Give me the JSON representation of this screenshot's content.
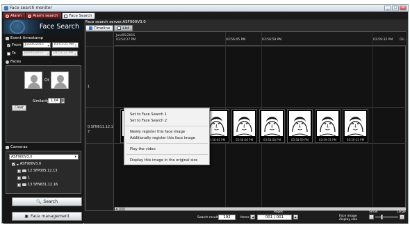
{
  "window": {
    "title": "Face search monitor",
    "min": "_",
    "max": "□",
    "close": "×"
  },
  "tabs": [
    {
      "label": "Alarm"
    },
    {
      "label": "Alarm search"
    },
    {
      "label": "Face Search"
    }
  ],
  "left": {
    "header_title": "Face Search",
    "event_timestamp_label": "Event timestamp",
    "from_label": "From",
    "from_date": "Jun/05/2015",
    "from_time": "03:51:21 PM",
    "to_label": "To",
    "to_date": "Jun/05/2015",
    "to_time": "04:51:21 PM",
    "faces_label": "Faces",
    "or_label": "Or",
    "similarity_label": "Similarity",
    "similarity_value": "1.04",
    "clear_button": "Clear",
    "cameras_label": "Cameras",
    "camera_select": "ASF900V3.0",
    "tree": [
      "ASF900V3.0",
      "12 SFP005.12.13",
      "1",
      "13 SFN631.12.16"
    ],
    "search_button": "Search",
    "face_management_button": "Face management"
  },
  "right": {
    "server_label": "Face search server:ASF900V3.0",
    "tab_timeline": "Timeline",
    "tab_list": "List",
    "time_header": {
      "date": "Jun/05/2015",
      "first_time": "03:54:27 PM",
      "t2": "03:56:05 PM",
      "t3": "03:56:59 PM",
      "t4": "03:59:32 PM",
      "t5": "03:..."
    },
    "row_labels": [
      "1",
      "0.SFN611.12.1",
      "7"
    ],
    "thumb_times": [
      "",
      "",
      "7 PM",
      "03:58:05 PM",
      "03:58:06 PM",
      "03:58:58 PM",
      "03:58:59 PM",
      "03:59:31 PM",
      "03:59:32 PM"
    ],
    "footer": {
      "search_result_label": "Search result",
      "search_result_value": "192",
      "items_label": "Items",
      "pages_label": "Pages",
      "page_current": "001",
      "page_total": "001",
      "page_sep": "/",
      "display_size_label": "Face image display size",
      "small_label": "Small",
      "large_label": "Large",
      "prev": "◀",
      "next": "▶",
      "minus": "-",
      "plus": "+"
    }
  },
  "context_menu": {
    "items": [
      "Set to Face Search 1",
      "Set to Face Search 2",
      "Newly register this face image",
      "Additionally register this face image",
      "Play the video",
      "Display this image in the original size"
    ]
  },
  "colors": {
    "selection": "#3cc44a",
    "alarm_tab": "#7a1f1f"
  }
}
